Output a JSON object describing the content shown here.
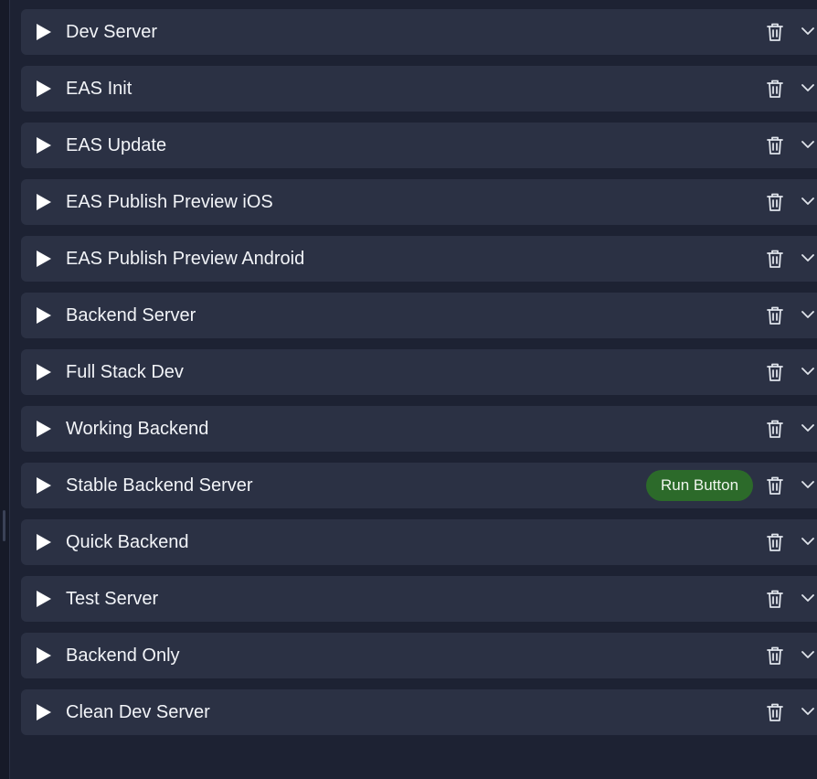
{
  "colors": {
    "background": "#1d2233",
    "item_background": "#2b3144",
    "text": "#f2f4f8",
    "icon": "#dfe3ea",
    "run_badge": "#2c6a2a"
  },
  "icons": {
    "play": "play-icon",
    "delete": "trash-icon",
    "expand": "chevron-down-icon"
  },
  "tasks": [
    {
      "label": "Dev Server"
    },
    {
      "label": "EAS Init"
    },
    {
      "label": "EAS Update"
    },
    {
      "label": "EAS Publish Preview iOS"
    },
    {
      "label": "EAS Publish Preview Android"
    },
    {
      "label": "Backend Server"
    },
    {
      "label": "Full Stack Dev"
    },
    {
      "label": "Working Backend"
    },
    {
      "label": "Stable Backend Server",
      "badge": "Run Button"
    },
    {
      "label": "Quick Backend"
    },
    {
      "label": "Test Server"
    },
    {
      "label": "Backend Only"
    },
    {
      "label": "Clean Dev Server"
    }
  ]
}
